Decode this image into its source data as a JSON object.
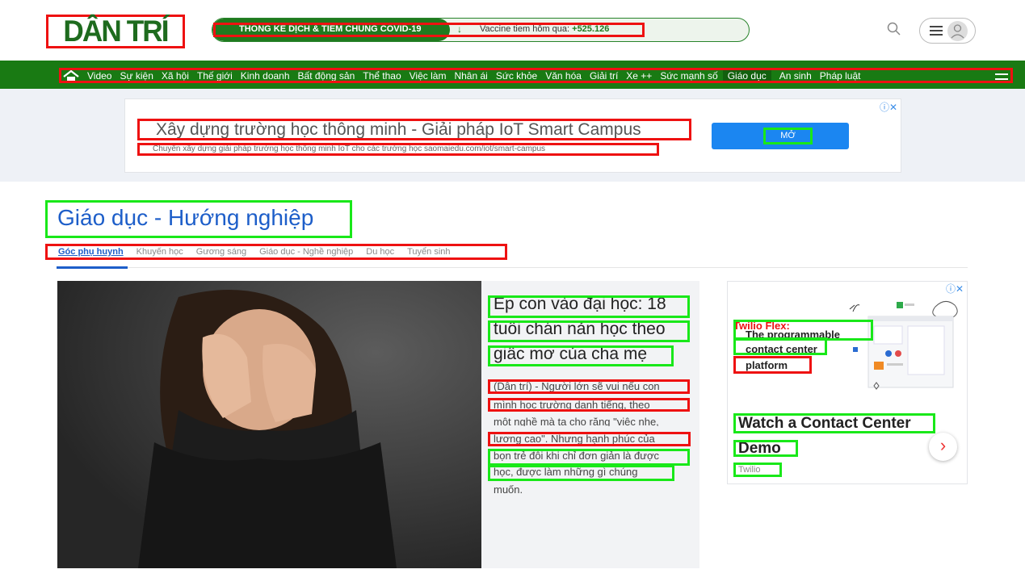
{
  "header": {
    "logo_text": "DÂN TRÍ",
    "covid_title": "THONG KE DỊCH & TIEM CHUNG COVID-19",
    "covid_arrow": "↓",
    "vaccine_label": "Vaccine tiem hôm qua: ",
    "vaccine_value": "+525.126",
    "search_icon": "search-icon",
    "menu_icon": "hamburger-icon",
    "avatar_icon": "user-avatar-icon"
  },
  "nav": {
    "items": [
      "Video",
      "Sự kiện",
      "Xã hội",
      "Thế giới",
      "Kinh doanh",
      "Bất động sản",
      "Thể thao",
      "Việc làm",
      "Nhân ái",
      "Sức khỏe",
      "Văn hóa",
      "Giải trí",
      "Xe ++",
      "Sức mạnh số",
      "Giáo dục",
      "An sinh",
      "Pháp luật"
    ],
    "active_item": "Giáo dục"
  },
  "ad_banner": {
    "title": "Xây dựng trường học thông minh - Giải pháp IoT Smart Campus",
    "subtitle": "Chuyên xây dựng giải pháp trường học thông minh IoT cho các trường học saomaiedu.com/iot/smart-campus",
    "button": "MỞ",
    "choices": "ⓘ✕"
  },
  "section": {
    "title": "Giáo dục - Hướng nghiệp",
    "tabs": [
      "Góc phụ huynh",
      "Khuyến học",
      "Gương sáng",
      "Giáo dục - Nghề nghiệp",
      "Du học",
      "Tuyển sinh"
    ],
    "active_tab": "Góc phụ huynh"
  },
  "feature": {
    "headline_lines": [
      "Ép con vào đại học: 18",
      "tuổi chán nản học theo",
      "giấc mơ của cha mẹ"
    ],
    "summary_lines": [
      "(Dân trí) - Người lớn sẽ vui nếu con",
      "mình học trường danh tiếng, theo",
      "một nghề mà ta cho rằng \"việc nhẹ,",
      "lương cao\". Nhưng hạnh phúc của",
      "bọn trẻ đôi khi chỉ đơn giản là được",
      "học, được làm những gì chúng",
      "muốn."
    ]
  },
  "side_ad": {
    "choices": "ⓘ✕",
    "promo_lines": [
      "Twilio Flex:",
      "The programmable",
      "contact center",
      "platform"
    ],
    "title_lines": [
      "Watch a Contact Center",
      "Demo"
    ],
    "brand": "Twilio",
    "next": "›"
  },
  "colors": {
    "brand_green": "#197a13",
    "link_blue": "#1d5ec9",
    "ad_button": "#1b86f1"
  }
}
